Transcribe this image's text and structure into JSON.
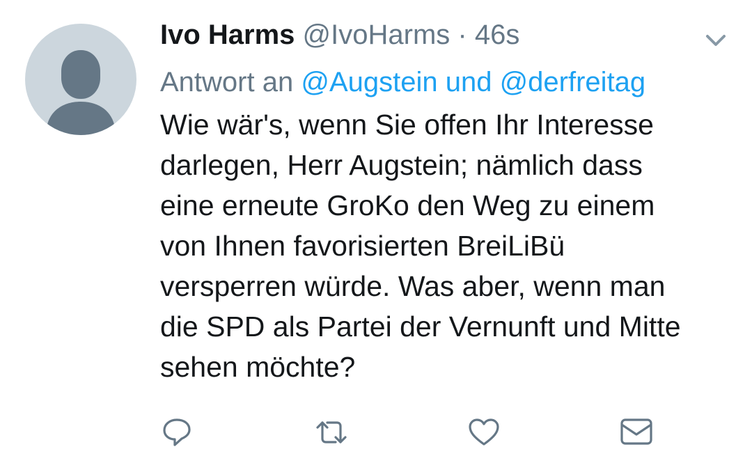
{
  "tweet": {
    "author": {
      "name": "Ivo Harms",
      "handle": "@IvoHarms",
      "separator": "·",
      "timestamp": "46s",
      "avatar_icon": "default-profile-avatar-icon"
    },
    "reply": {
      "label": "Antwort an",
      "mentions": "@Augstein und @derfreitag"
    },
    "text_lines": [
      "Wie wär's, wenn Sie offen Ihr Interesse",
      "darlegen, Herr Augstein; nämlich dass",
      "eine erneute GroKo den Weg zu einem",
      "von Ihnen favorisierten BreiLiBü",
      "versperren würde. Was aber, wenn man",
      "die SPD als Partei der Vernunft und Mitte",
      "sehen möchte?"
    ],
    "menu_icon": "chevron-down-icon",
    "actions": [
      {
        "id": "reply",
        "icon": "reply-icon"
      },
      {
        "id": "retweet",
        "icon": "retweet-icon"
      },
      {
        "id": "like",
        "icon": "heart-icon"
      },
      {
        "id": "direct-message",
        "icon": "envelope-icon"
      }
    ]
  },
  "colors": {
    "text_primary": "#14171a",
    "text_secondary": "#657786",
    "link": "#1da1f2",
    "avatar_bg": "#ccd6dd",
    "avatar_fg": "#657786",
    "icon": "#657786",
    "chevron": "#8899a6"
  }
}
